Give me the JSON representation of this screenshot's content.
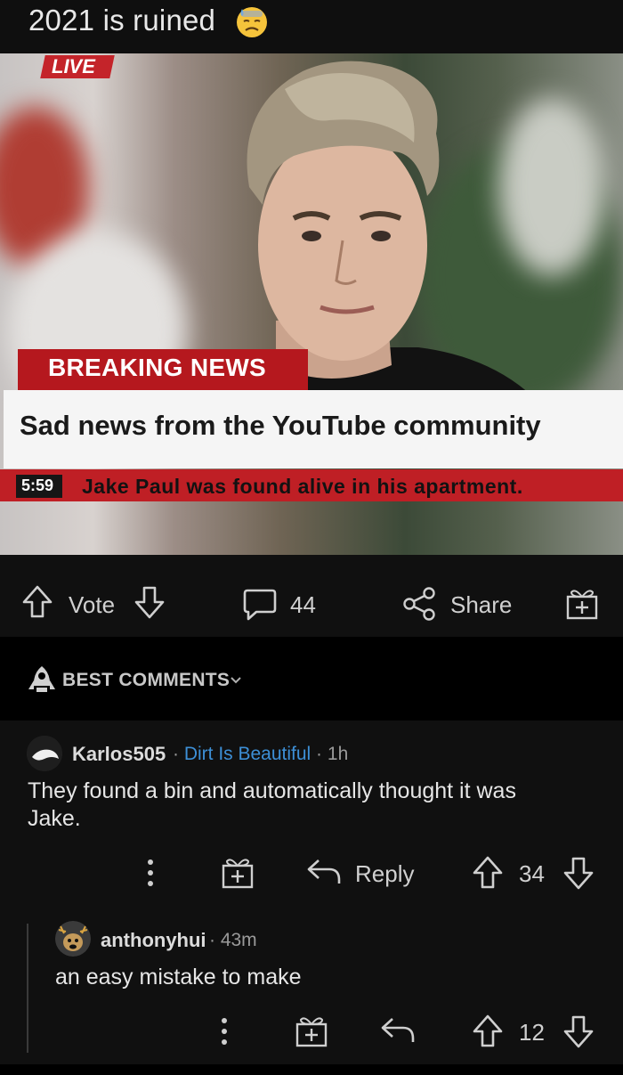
{
  "post": {
    "title": "2021 is ruined",
    "emoji": "sad-sweat-emoji"
  },
  "meme": {
    "live_label": "LIVE",
    "breaking_label": "BREAKING NEWS",
    "headline": "Sad news from the YouTube community",
    "time": "5:59",
    "ticker": "Jake Paul was found alive in his apartment."
  },
  "actions": {
    "vote_label": "Vote",
    "comment_count": "44",
    "share_label": "Share"
  },
  "sort": {
    "label": "BEST COMMENTS"
  },
  "comments": [
    {
      "username": "Karlos505",
      "flair": "Dirt Is Beautiful",
      "age": "1h",
      "body_line1": "They found a bin and automatically thought it was",
      "body_line2": "Jake.",
      "reply_label": "Reply",
      "score": "34"
    },
    {
      "username": "anthonyhui",
      "age": "43m",
      "body": "an easy mistake to make",
      "score": "12"
    }
  ],
  "colors": {
    "background": "#0b0b0b",
    "breaking_red": "#b5181e",
    "flair_blue": "#3d8fd6"
  }
}
